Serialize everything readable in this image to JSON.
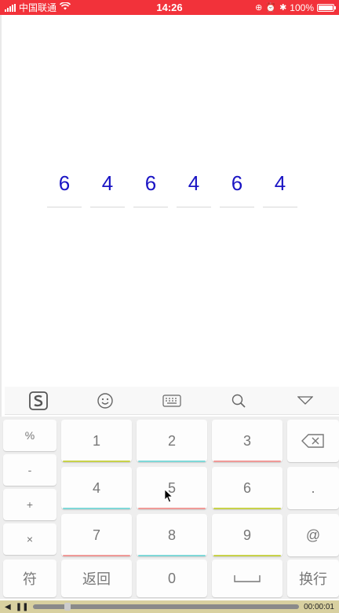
{
  "status": {
    "carrier": "中国联通",
    "time": "14:26",
    "battery": "100%"
  },
  "code": {
    "digits": [
      "6",
      "4",
      "6",
      "4",
      "6",
      "4"
    ]
  },
  "keyboard": {
    "left_column": [
      "%",
      "-",
      "+",
      "×",
      "符"
    ],
    "rows": [
      [
        "1",
        "2",
        "3"
      ],
      [
        "4",
        "5",
        "6"
      ],
      [
        "7",
        "8",
        "9"
      ]
    ],
    "bottom": {
      "back": "返回",
      "zero": "0"
    },
    "right_column": {
      "dot": ".",
      "at": "@",
      "enter": "换行"
    }
  },
  "player": {
    "time": "00:00:01"
  },
  "colors": {
    "status_bar": "#f2323a",
    "digit": "#1a14c4",
    "accent_yellow": "#c8d24a",
    "accent_cyan": "#7fd8d8",
    "accent_red": "#f09a98"
  }
}
